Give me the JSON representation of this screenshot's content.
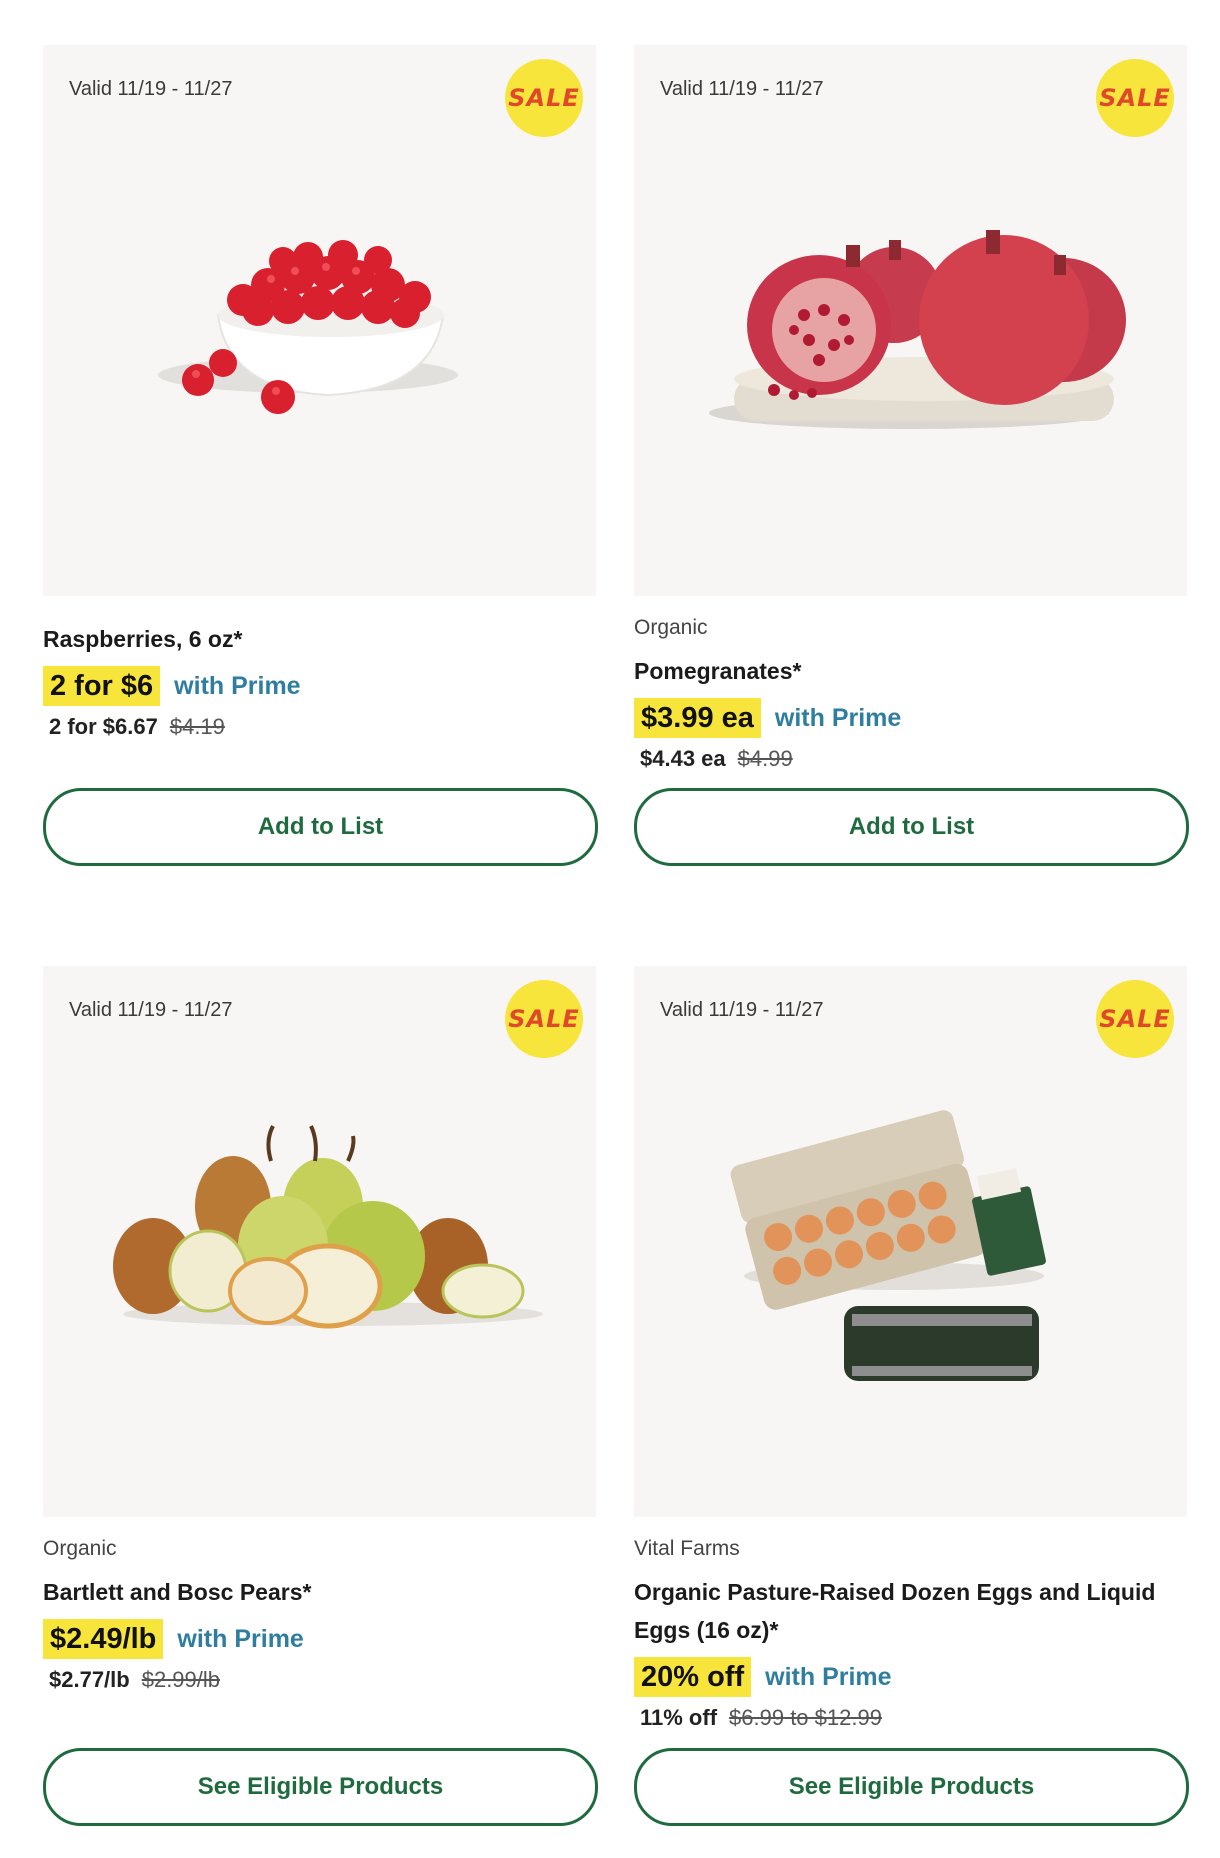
{
  "products": [
    {
      "valid": "Valid 11/19 - 11/27",
      "badge": "SALE",
      "brand": "",
      "name": "Raspberries, 6 oz*",
      "prime_price": "2 for $6",
      "with_prime": "with Prime",
      "regular_price": "2 for $6.67",
      "original_price": "$4.19",
      "action": "Add to List",
      "image_icon": "raspberries-image"
    },
    {
      "valid": "Valid 11/19 - 11/27",
      "badge": "SALE",
      "brand": "Organic",
      "name": "Pomegranates*",
      "prime_price": "$3.99 ea",
      "with_prime": "with Prime",
      "regular_price": "$4.43 ea",
      "original_price": "$4.99",
      "action": "Add to List",
      "image_icon": "pomegranates-image"
    },
    {
      "valid": "Valid 11/19 - 11/27",
      "badge": "SALE",
      "brand": "Organic",
      "name": "Bartlett and Bosc Pears*",
      "prime_price": "$2.49/lb",
      "with_prime": "with Prime",
      "regular_price": "$2.77/lb",
      "original_price": "$2.99/lb",
      "action": "See Eligible Products",
      "image_icon": "pears-image"
    },
    {
      "valid": "Valid 11/19 - 11/27",
      "badge": "SALE",
      "brand": "Vital Farms",
      "name": "Organic Pasture-Raised Dozen Eggs and Liquid Eggs (16 oz)*",
      "prime_price": "20% off",
      "with_prime": "with Prime",
      "regular_price": "11% off",
      "original_price": "$6.99 to $12.99",
      "action": "See Eligible Products",
      "image_icon": "eggs-image"
    }
  ],
  "colors": {
    "sale_yellow": "#f7e53b",
    "sale_text": "#e0482a",
    "prime_blue": "#2f7ea0",
    "button_green": "#1f6b3f",
    "image_bg": "#f8f6f4"
  }
}
